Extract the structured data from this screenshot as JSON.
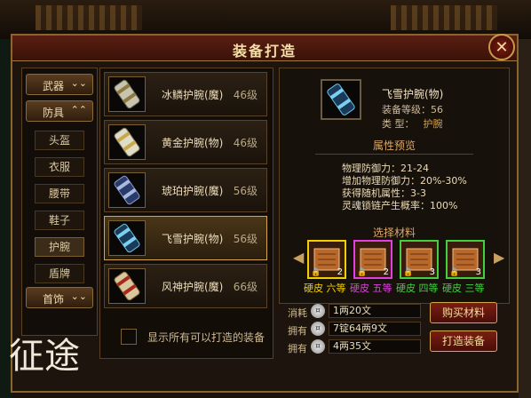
{
  "window": {
    "title": "装备打造",
    "close_label": "✕"
  },
  "categories": [
    {
      "label": "武器",
      "chev": "⌄⌄"
    },
    {
      "label": "防具",
      "chev": "⌃⌃"
    },
    {
      "label": "首饰",
      "chev": "⌄⌄"
    }
  ],
  "subcategories": [
    "头盔",
    "衣服",
    "腰带",
    "鞋子",
    "护腕",
    "盾牌"
  ],
  "items": [
    {
      "name": "冰鳞护腕(魔)",
      "level": "46级"
    },
    {
      "name": "黄金护腕(物)",
      "level": "46级"
    },
    {
      "name": "琥珀护腕(魔)",
      "level": "56级"
    },
    {
      "name": "飞雪护腕(物)",
      "level": "56级"
    },
    {
      "name": "风神护腕(魔)",
      "level": "66级"
    }
  ],
  "show_all_label": "显示所有可以打造的装备",
  "detail": {
    "name": "飞雪护腕(物)",
    "level_line": "装备等级：56",
    "type_key": "类    型：",
    "type_value": "护腕",
    "attr_title": "属性预览",
    "stats": [
      "物理防御力：21-24",
      "增加物理防御力：20%-30%",
      "获得随机属性：3-3",
      "灵魂锁链产生概率：100%"
    ],
    "materials_title": "选择材料",
    "materials": [
      {
        "count": "2",
        "label": "硬皮 六等",
        "color": "#f0d000"
      },
      {
        "count": "2",
        "label": "硬皮 五等",
        "color": "#e040e0"
      },
      {
        "count": "3",
        "label": "硬皮 四等",
        "color": "#40d040"
      },
      {
        "count": "3",
        "label": "硬皮 三等",
        "color": "#40d040"
      }
    ]
  },
  "resources": [
    {
      "key": "消耗",
      "value": "1两20文"
    },
    {
      "key": "拥有",
      "value": "7锭64两9文"
    },
    {
      "key": "拥有",
      "value": "4两35文"
    }
  ],
  "buttons": {
    "buy": "购买材料",
    "craft": "打造装备"
  },
  "logo_text": "征途"
}
